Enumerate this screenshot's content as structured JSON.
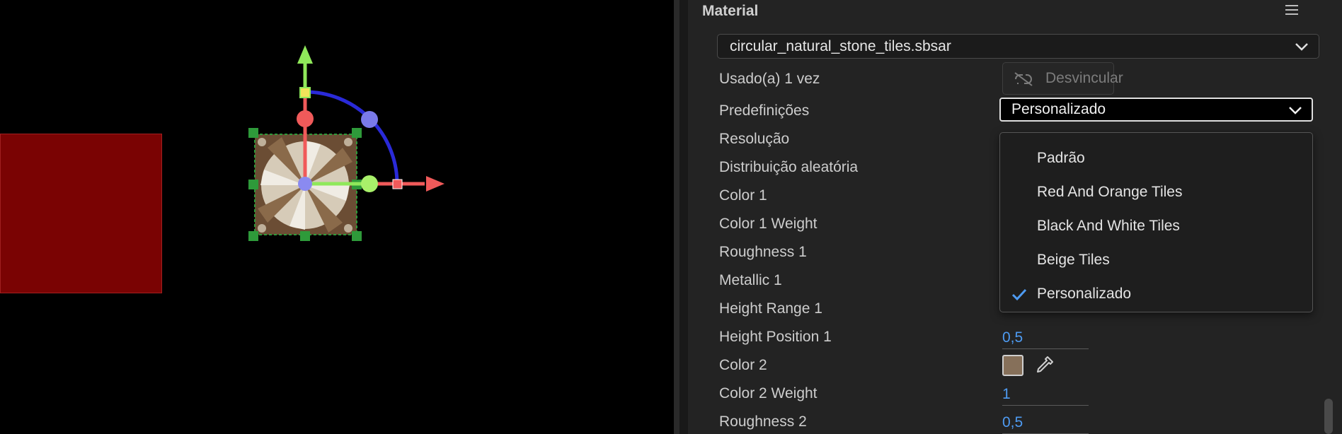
{
  "panel": {
    "title": "Material",
    "file_select": {
      "value": "circular_natural_stone_tiles.sbsar"
    },
    "usage_label": "Usado(a) 1 vez",
    "unlink_button": "Desvincular",
    "presets": {
      "label": "Predefinições",
      "selected": "Personalizado",
      "options": [
        "Padrão",
        "Red And Orange Tiles",
        "Black And White Tiles",
        "Beige Tiles",
        "Personalizado"
      ]
    },
    "properties": [
      "Resolução",
      "Distribuição aleatória",
      "Color 1",
      "Color 1 Weight",
      "Roughness 1",
      "Metallic 1",
      "Height Range 1",
      "Height Position 1",
      "Color 2",
      "Color 2 Weight",
      "Roughness 2"
    ],
    "values": {
      "height_position_1": "0,5",
      "color_2_weight": "1",
      "roughness_2": "0,5"
    },
    "color_2_swatch": "#86705a"
  },
  "icons": {
    "menu": "hamburger-menu-icon",
    "chevron": "chevron-down-icon",
    "unlink": "unlink-icon",
    "check": "checkmark-icon",
    "eyedropper": "eyedropper-icon"
  },
  "colors": {
    "accent": "#4e9bf2",
    "viewport_object": "#7a0303",
    "gizmo_x": "#f05a5a",
    "gizmo_y": "#8fe85a",
    "gizmo_rotate": "#2a2ad8",
    "selection_handles": "#2e9a3a"
  }
}
